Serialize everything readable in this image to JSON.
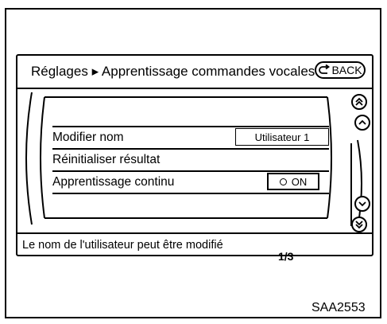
{
  "header": {
    "breadcrumb_root": "Réglages",
    "breadcrumb_sep": "▸",
    "breadcrumb_current": "Apprentissage commandes vocales",
    "back_label": "BACK"
  },
  "menu": {
    "items": [
      {
        "label": "Modifier nom",
        "value": "Utilisateur 1"
      },
      {
        "label": "Réinitialiser résultat"
      },
      {
        "label": "Apprentissage continu",
        "toggle_label": "ON",
        "toggle_on": true
      }
    ],
    "page_indicator": "1/3"
  },
  "status_bar": {
    "message": "Le nom de l'utilisateur peut être modifié"
  },
  "figure_code": "SAA2553",
  "icons": {
    "back": "back-arrow-icon",
    "page_up": "double-chevron-up-icon",
    "line_up": "chevron-up-icon",
    "line_down": "chevron-down-icon",
    "page_down": "double-chevron-down-icon"
  }
}
